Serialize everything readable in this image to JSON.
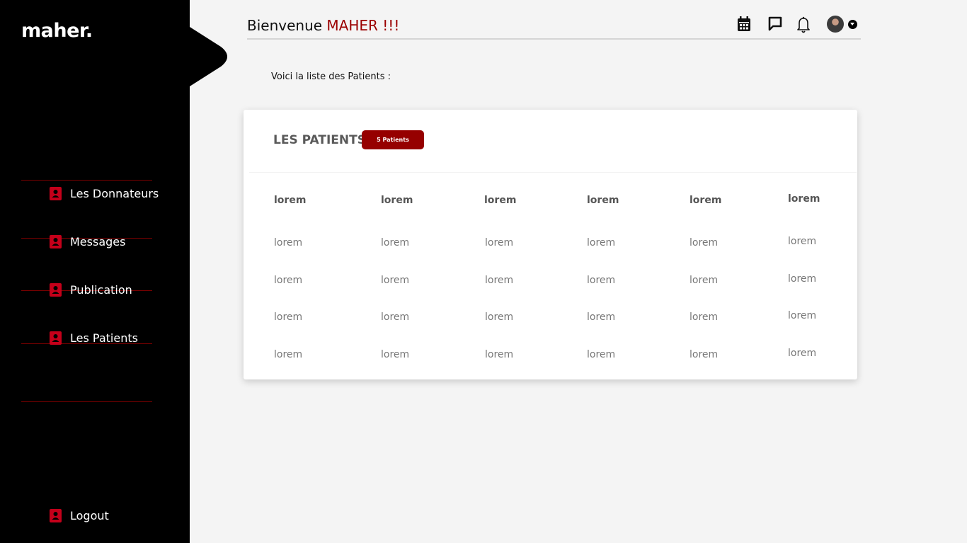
{
  "sidebar": {
    "logo": "maher.",
    "items": [
      {
        "label": "Les Donnateurs"
      },
      {
        "label": "Messages"
      },
      {
        "label": "Publication"
      },
      {
        "label": "Les Patients"
      }
    ],
    "logout": "Logout"
  },
  "header": {
    "greeting": "Bienvenue",
    "user_name": "MAHER !!!",
    "icons": [
      "calendar-icon",
      "chat-icon",
      "bell-icon",
      "avatar",
      "chevron-down-icon"
    ]
  },
  "intro_text": "Voici la liste des Patients :",
  "card": {
    "title": "LES PATIENTS",
    "badge": "5 Patients",
    "columns": [
      "lorem",
      "lorem",
      "lorem",
      "lorem",
      "lorem",
      "lorem"
    ],
    "rows": [
      [
        "lorem",
        "lorem",
        "lorem",
        "lorem",
        "lorem",
        "lorem"
      ],
      [
        "lorem",
        "lorem",
        "lorem",
        "lorem",
        "lorem",
        "lorem"
      ],
      [
        "lorem",
        "lorem",
        "lorem",
        "lorem",
        "lorem",
        "lorem"
      ],
      [
        "lorem",
        "lorem",
        "lorem",
        "lorem",
        "lorem",
        "lorem"
      ]
    ]
  },
  "colors": {
    "sidebar_bg": "#000000",
    "accent_red": "#9b0000",
    "page_bg": "#f4f4f4"
  }
}
